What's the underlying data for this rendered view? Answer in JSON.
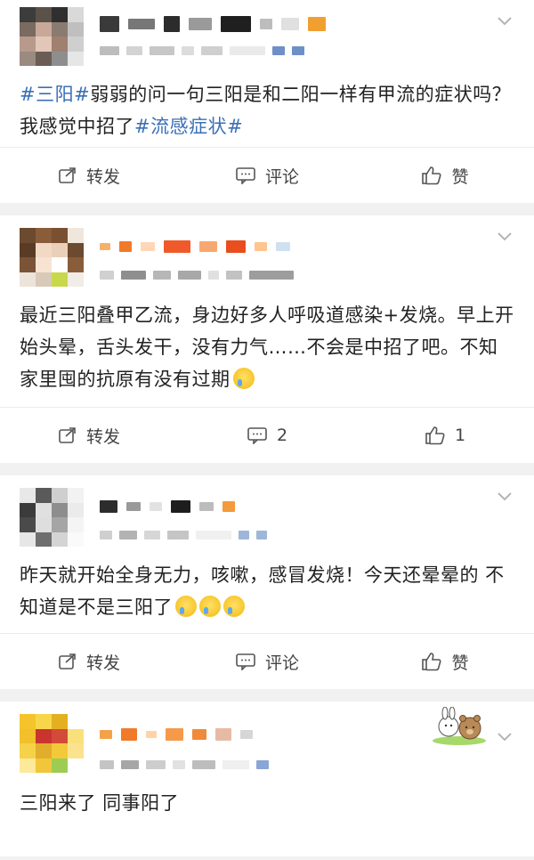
{
  "posts": [
    {
      "content": {
        "tag1": "#三阳#",
        "text1": "弱弱的问一句三阳是和二阳一样有甲流的症状吗？我感觉中招了",
        "tag2": "#流感症状#"
      },
      "actions": {
        "repost": "转发",
        "comment": "评论",
        "like": "赞"
      }
    },
    {
      "content": {
        "text1": "最近三阳叠甲乙流，身边好多人呼吸道感染+发烧。早上开始头晕，舌头发干，没有力气……不会是中招了吧。不知家里囤的抗原有没有过期",
        "emoji_icons": [
          "crying-face-icon"
        ]
      },
      "actions": {
        "repost": "转发",
        "comment": "2",
        "like": "1"
      }
    },
    {
      "content": {
        "text1": "昨天就开始全身无力，咳嗽，感冒发烧！今天还晕晕的 不知道是不是三阳了",
        "emoji_icons": [
          "sweat-face-icon",
          "sweat-face-icon",
          "sweat-face-icon"
        ]
      },
      "actions": {
        "repost": "转发",
        "comment": "评论",
        "like": "赞"
      }
    },
    {
      "content": {
        "text1": "三阳来了 同事阳了"
      }
    }
  ],
  "colors": {
    "tag": "#3b6fb6",
    "background": "#f1f1f1",
    "card": "#ffffff"
  }
}
